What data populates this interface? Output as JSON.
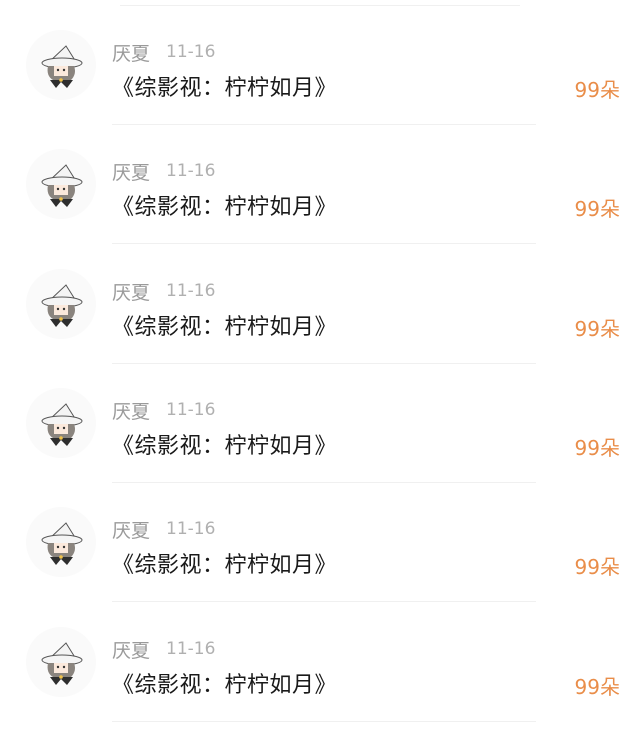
{
  "comments": [
    {
      "username": "厌夏",
      "date": "11-16",
      "text": "《综影视：柠柠如月》",
      "gift": "99朵"
    },
    {
      "username": "厌夏",
      "date": "11-16",
      "text": "《综影视：柠柠如月》",
      "gift": "99朵"
    },
    {
      "username": "厌夏",
      "date": "11-16",
      "text": "《综影视：柠柠如月》",
      "gift": "99朵"
    },
    {
      "username": "厌夏",
      "date": "11-16",
      "text": "《综影视：柠柠如月》",
      "gift": "99朵"
    },
    {
      "username": "厌夏",
      "date": "11-16",
      "text": "《综影视：柠柠如月》",
      "gift": "99朵"
    },
    {
      "username": "厌夏",
      "date": "11-16",
      "text": "《综影视：柠柠如月》",
      "gift": "99朵"
    }
  ],
  "colors": {
    "gift": "#e98d49",
    "username": "#9a9a9a",
    "date": "#b0b0b0",
    "text": "#1a1a1a"
  },
  "icons": {
    "avatar": "witch-hat-cartoon-avatar"
  }
}
